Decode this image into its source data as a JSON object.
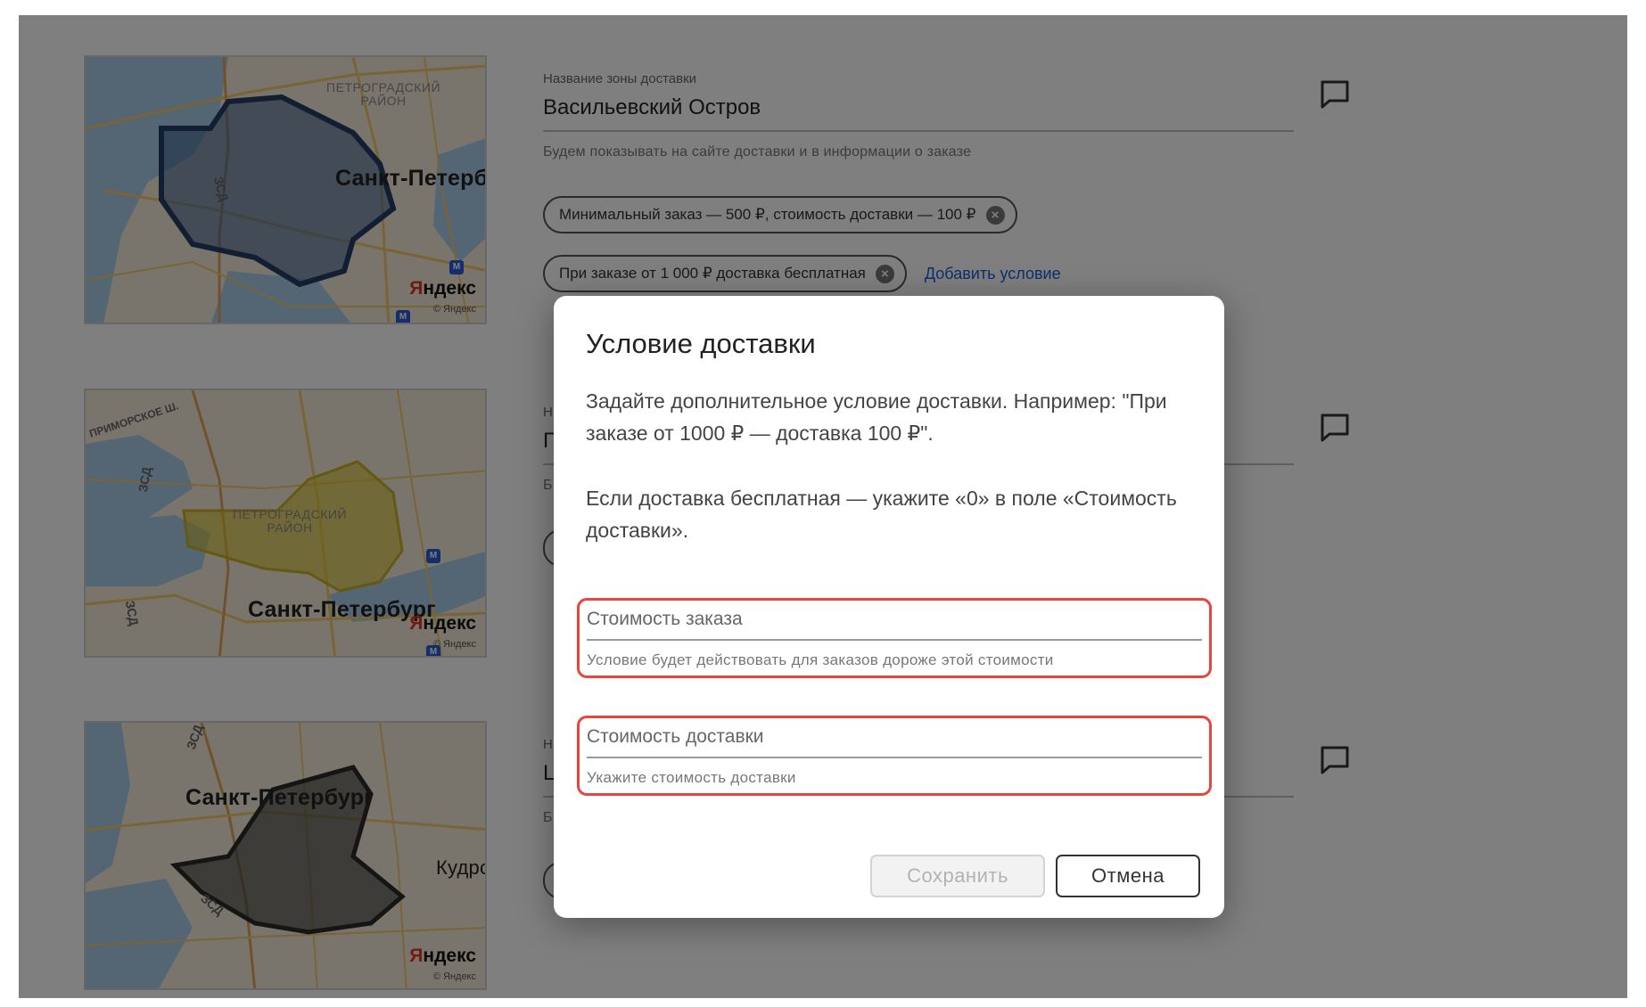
{
  "zones": [
    {
      "map": {
        "city": "Санкт-Петербург",
        "city_visible": "Санкт-Петерб",
        "district": "ПЕТРОГРАДСКИЙ РАЙОН",
        "road": "ЗСД",
        "brand": "Яндекс",
        "copyright": "© Яндекс",
        "zone_color": "#3b5f8f"
      },
      "name_caption": "Название зоны доставки",
      "name_value": "Васильевский Остров",
      "name_hint": "Будем показывать на сайте доставки и в информации о заказе",
      "conditions": [
        "Минимальный заказ — 500 ₽, стоимость доставки — 100 ₽",
        "При заказе от 1 000 ₽ доставка бесплатная"
      ],
      "add_condition_label": "Добавить условие"
    },
    {
      "map": {
        "city": "Санкт-Петербург",
        "district": "ПЕТРОГРАДСКИЙ РАЙОН",
        "road": "ЗСД",
        "road2": "ПРИМОРСКОЕ Ш.",
        "brand": "Яндекс",
        "copyright": "© Яндекс",
        "zone_color": "#d9c22a"
      },
      "name_caption_initial": "Н",
      "name_value_initial": "П",
      "name_hint_initial": "Б"
    },
    {
      "map": {
        "city": "Санкт-Петербург",
        "road": "ЗСД",
        "suburb": "Кудро",
        "brand": "Яндекс",
        "copyright": "© Яндекс",
        "zone_color": "#3a3a3a"
      },
      "name_caption_initial": "Н",
      "name_value_initial": "L",
      "name_hint_initial": "Б"
    }
  ],
  "modal": {
    "title": "Условие доставки",
    "paragraph1": "Задайте дополнительное условие доставки. Например: \"При заказе от 1000 ₽ — доставка 100 ₽\".",
    "paragraph2": "Если доставка бесплатная — укажите «0» в поле «Стоимость доставки».",
    "order_cost": {
      "label": "Стоимость заказа",
      "hint": "Условие будет действовать для заказов дороже этой стоимости"
    },
    "delivery_cost": {
      "label": "Стоимость доставки",
      "hint": "Укажите стоимость доставки"
    },
    "save_label": "Сохранить",
    "cancel_label": "Отмена"
  },
  "colors": {
    "error_border": "#e8453c",
    "link": "#1a5fd6",
    "overlay": "rgba(0,0,0,0.5)"
  }
}
